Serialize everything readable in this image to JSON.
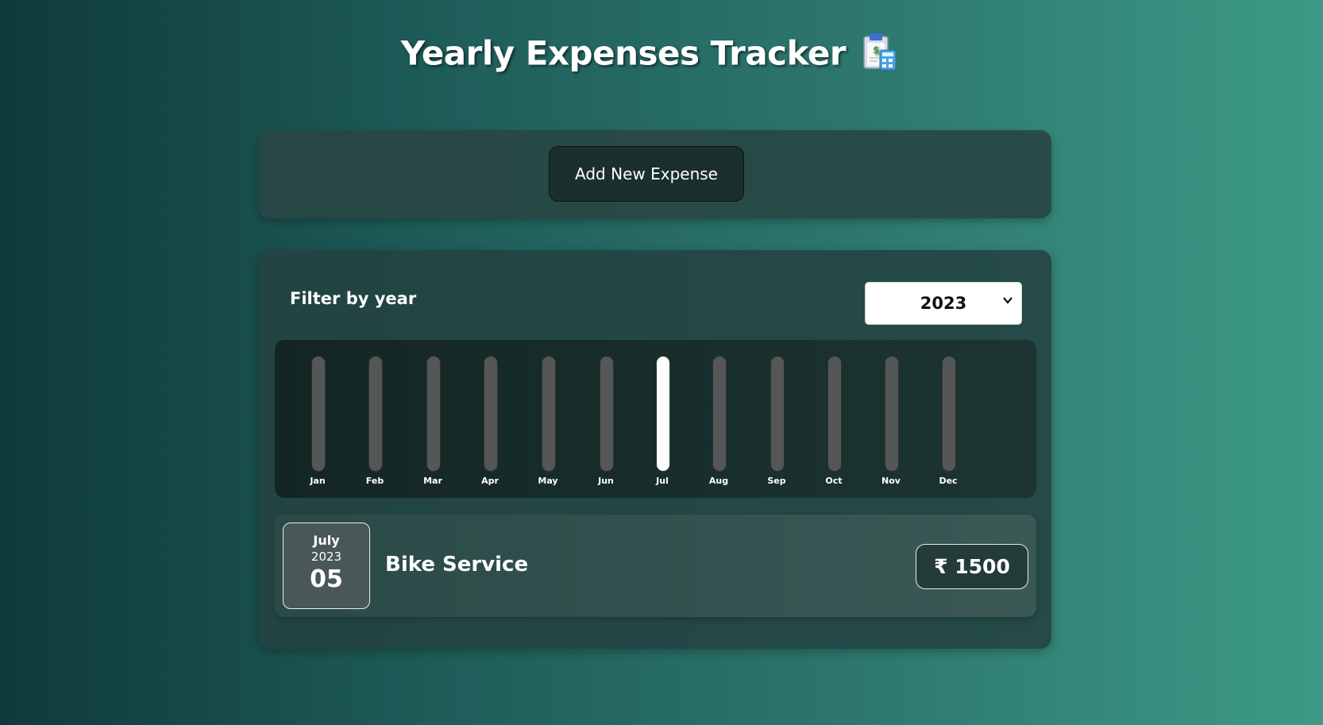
{
  "header": {
    "title": "Yearly Expenses Tracker",
    "icon": "clipboard-calculator-icon"
  },
  "new_expense": {
    "button_label": "Add New Expense"
  },
  "filter": {
    "label": "Filter by year",
    "selected_year": "2023"
  },
  "chart_data": {
    "type": "bar",
    "categories": [
      "Jan",
      "Feb",
      "Mar",
      "Apr",
      "May",
      "Jun",
      "Jul",
      "Aug",
      "Sep",
      "Oct",
      "Nov",
      "Dec"
    ],
    "values": [
      0,
      0,
      0,
      0,
      0,
      0,
      1500,
      0,
      0,
      0,
      0,
      0
    ],
    "ylim": [
      0,
      1500
    ],
    "fill_color": "#ffffff",
    "track_color": "#555757"
  },
  "expenses": [
    {
      "month": "July",
      "year": "2023",
      "day": "05",
      "title": "Bike Service",
      "amount": "₹ 1500"
    }
  ],
  "colors": {
    "accent_dark": "#1b2f2d",
    "background_start": "#0f3a3b",
    "background_end": "#3d9a86"
  }
}
